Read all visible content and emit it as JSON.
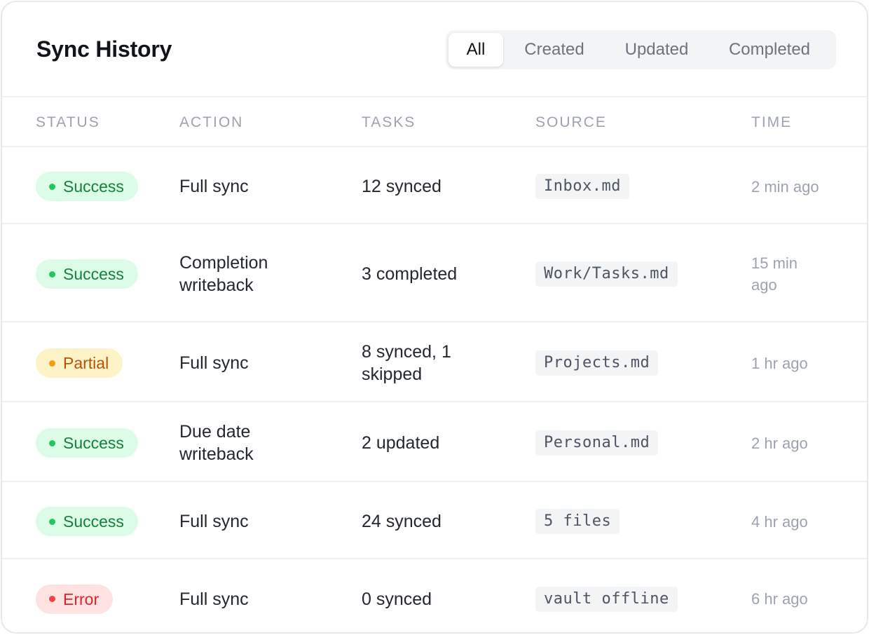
{
  "title": "Sync History",
  "filters": [
    "All",
    "Created",
    "Updated",
    "Completed"
  ],
  "active_filter": "All",
  "columns": [
    "STATUS",
    "ACTION",
    "TASKS",
    "SOURCE",
    "TIME"
  ],
  "rows": [
    {
      "status": "Success",
      "status_type": "success",
      "action": "Full sync",
      "tasks": "12 synced",
      "source": "Inbox.md",
      "time": "2 min ago"
    },
    {
      "status": "Success",
      "status_type": "success",
      "action": "Completion writeback",
      "tasks": "3 completed",
      "source": "Work/Tasks.md",
      "time": "15 min ago"
    },
    {
      "status": "Partial",
      "status_type": "partial",
      "action": "Full sync",
      "tasks": "8 synced, 1 skipped",
      "source": "Projects.md",
      "time": "1 hr ago"
    },
    {
      "status": "Success",
      "status_type": "success",
      "action": "Due date writeback",
      "tasks": "2 updated",
      "source": "Personal.md",
      "time": "2 hr ago"
    },
    {
      "status": "Success",
      "status_type": "success",
      "action": "Full sync",
      "tasks": "24 synced",
      "source": "5 files",
      "time": "4 hr ago"
    },
    {
      "status": "Error",
      "status_type": "error",
      "action": "Full sync",
      "tasks": "0 synced",
      "source": "vault offline",
      "time": "6 hr ago"
    }
  ],
  "colors": {
    "success_bg": "#dcfce7",
    "success_text": "#15803d",
    "partial_bg": "#fef3c7",
    "partial_text": "#b45309",
    "error_bg": "#fee2e2",
    "error_text": "#dc2626"
  }
}
